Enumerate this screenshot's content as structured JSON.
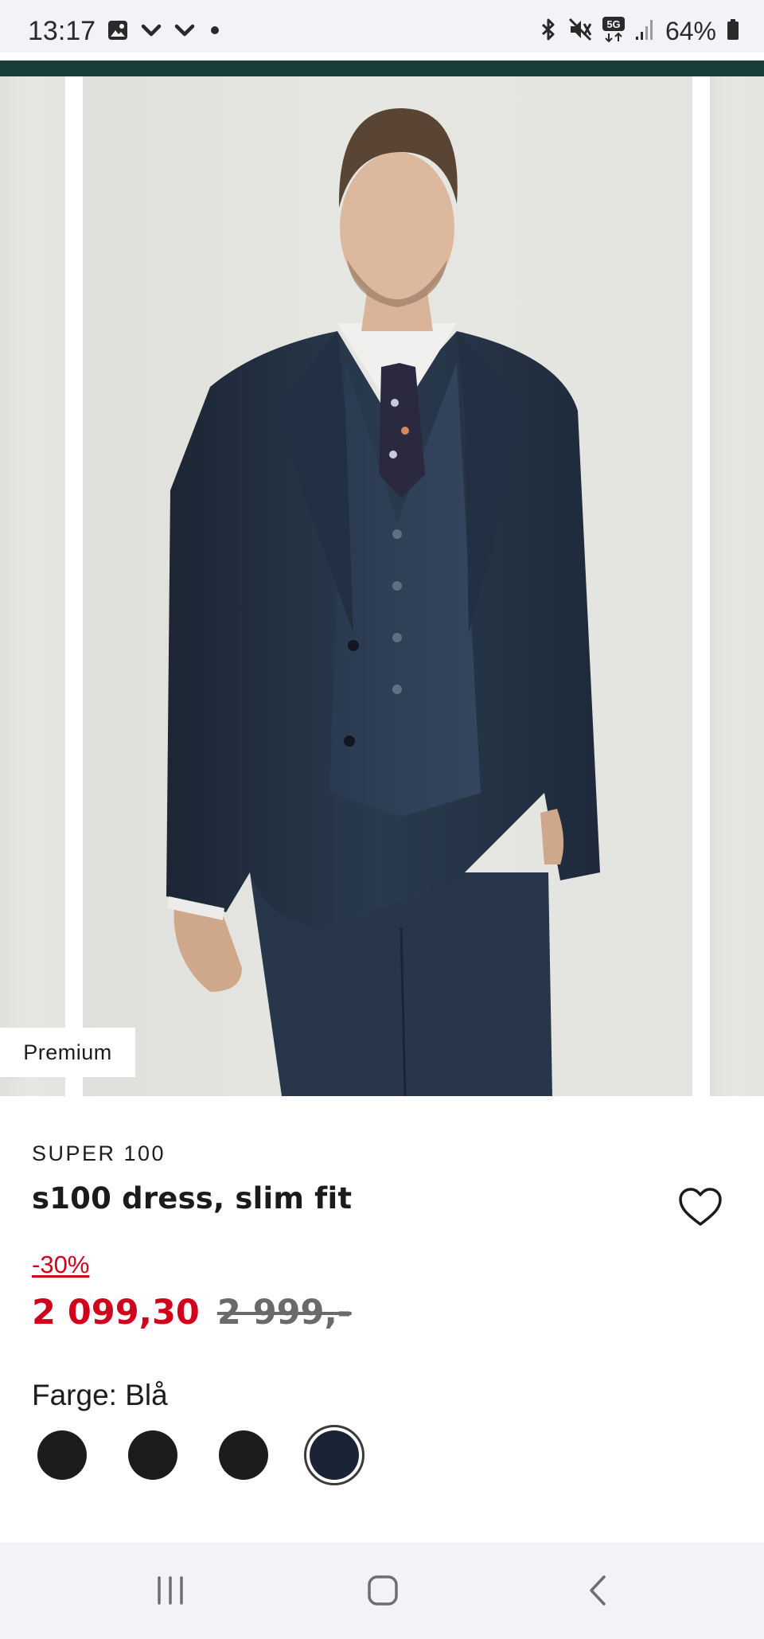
{
  "status_bar": {
    "time": "13:17",
    "battery": "64%",
    "left_icons": [
      "gallery-icon",
      "chevron-down-icon",
      "chevron-down-icon",
      "dot-icon"
    ],
    "right_icons": [
      "bluetooth-icon",
      "mute-icon",
      "5g-icon",
      "signal-icon",
      "battery-icon"
    ]
  },
  "colors": {
    "accent": "#173e3b",
    "sale_red": "#d0021b",
    "suit_navy": "#1e2a3c"
  },
  "carousel": {
    "badge": "Premium"
  },
  "product": {
    "brand": "SUPER 100",
    "title": "s100 dress, slim fit",
    "discount": "-30%",
    "price_now": "2 099,30",
    "price_old": "2 999,-",
    "color_label": "Farge: Blå",
    "swatches": [
      {
        "color": "#1c1c1e",
        "selected": false
      },
      {
        "color": "#1c1c1e",
        "selected": false
      },
      {
        "color": "#1c1c1e",
        "selected": false
      },
      {
        "color": "#1b2436",
        "selected": true
      }
    ]
  },
  "nav": {
    "icons": [
      "recent-apps-icon",
      "home-icon",
      "back-icon"
    ]
  }
}
